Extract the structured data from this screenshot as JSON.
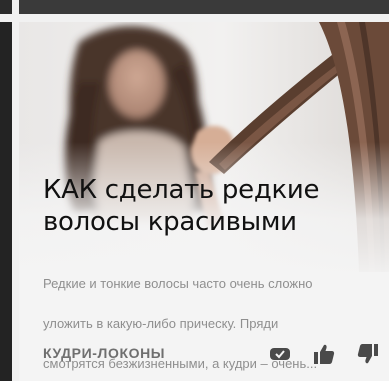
{
  "card": {
    "title_line1": "КАК сделать редкие",
    "title_line2": "волосы красивыми",
    "excerpt_line1": "Редкие и тонкие волосы часто очень сложно",
    "excerpt_line2": "уложить в какую-либо прическу. Пряди",
    "excerpt_line3": "смотрятся безжизненными, а кудри – очень...",
    "tag": "КУДРИ-ЛОКОНЫ",
    "image": "woman-holding-hair-photo"
  },
  "actions": {
    "hide_icon": "hide-icon",
    "like_icon": "thumbs-up-icon",
    "dislike_icon": "thumbs-down-icon"
  },
  "colors": {
    "title": "#111111",
    "excerpt": "#8f8f8f",
    "tag": "#6f6f6f",
    "icons": "#4a4a4a"
  }
}
